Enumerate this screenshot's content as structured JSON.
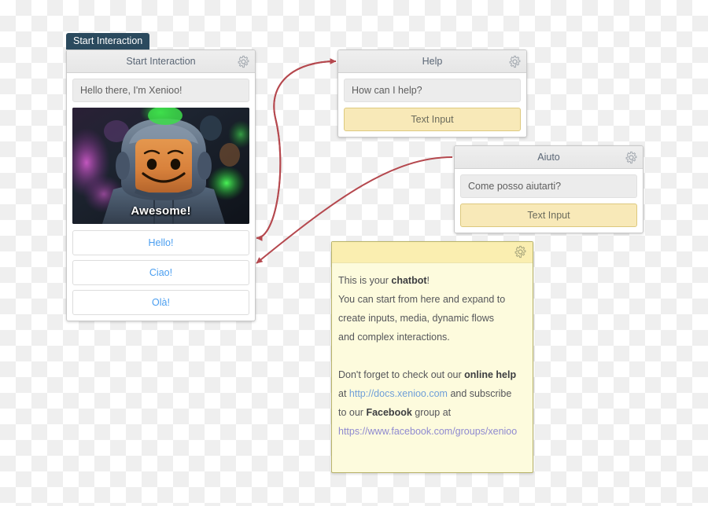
{
  "canvas": {
    "background_pattern": "checkerboard",
    "checker_colors": [
      "#ffffff",
      "#efefef"
    ],
    "connector_color": "#b5484e"
  },
  "tab": {
    "label": "Start Interaction",
    "background": "#2b4a5e",
    "text_color": "#ffffff"
  },
  "cards": {
    "start_interaction": {
      "title": "Start Interaction",
      "gear_icon": "gear-icon",
      "message": "Hello there, I'm Xenioo!",
      "media": {
        "type": "gif",
        "caption": "Awesome!",
        "alt": "LEGO astronaut minifigure smiling"
      },
      "choices": [
        {
          "label": "Hello!"
        },
        {
          "label": "Ciao!"
        },
        {
          "label": "Olà!"
        }
      ]
    },
    "help": {
      "title": "Help",
      "gear_icon": "gear-icon",
      "prompt": "How can I help?",
      "input_label": "Text Input"
    },
    "aiuto": {
      "title": "Aiuto",
      "gear_icon": "gear-icon",
      "prompt": "Come posso aiutarti?",
      "input_label": "Text Input"
    },
    "note": {
      "gear_icon": "gear-icon",
      "lines": [
        "This is your chatbot!",
        "You can start from here and expand to",
        "create inputs, media, dynamic flows",
        "and complex interactions.",
        "Don't forget to check out our online help",
        "at http://docs.xenioo.com and subscribe",
        "to our Facebook group at",
        "https://www.facebook.com/groups/xenioo"
      ],
      "l1_pre": "This is your ",
      "l1_bold": "chatbot",
      "l1_post": "!",
      "l2": "You can start from here and expand to",
      "l3": "create inputs, media, dynamic flows",
      "l4": "and complex interactions.",
      "l5_pre": "Don't forget to check out our ",
      "l5_bold": "online help",
      "l6_pre": "at ",
      "l6_link": "http://docs.xenioo.com",
      "l6_post": " and subscribe",
      "l7_pre": "to our ",
      "l7_bold": "Facebook",
      "l7_post": " group at",
      "l8_link": "https://www.facebook.com/groups/xenioo"
    }
  }
}
